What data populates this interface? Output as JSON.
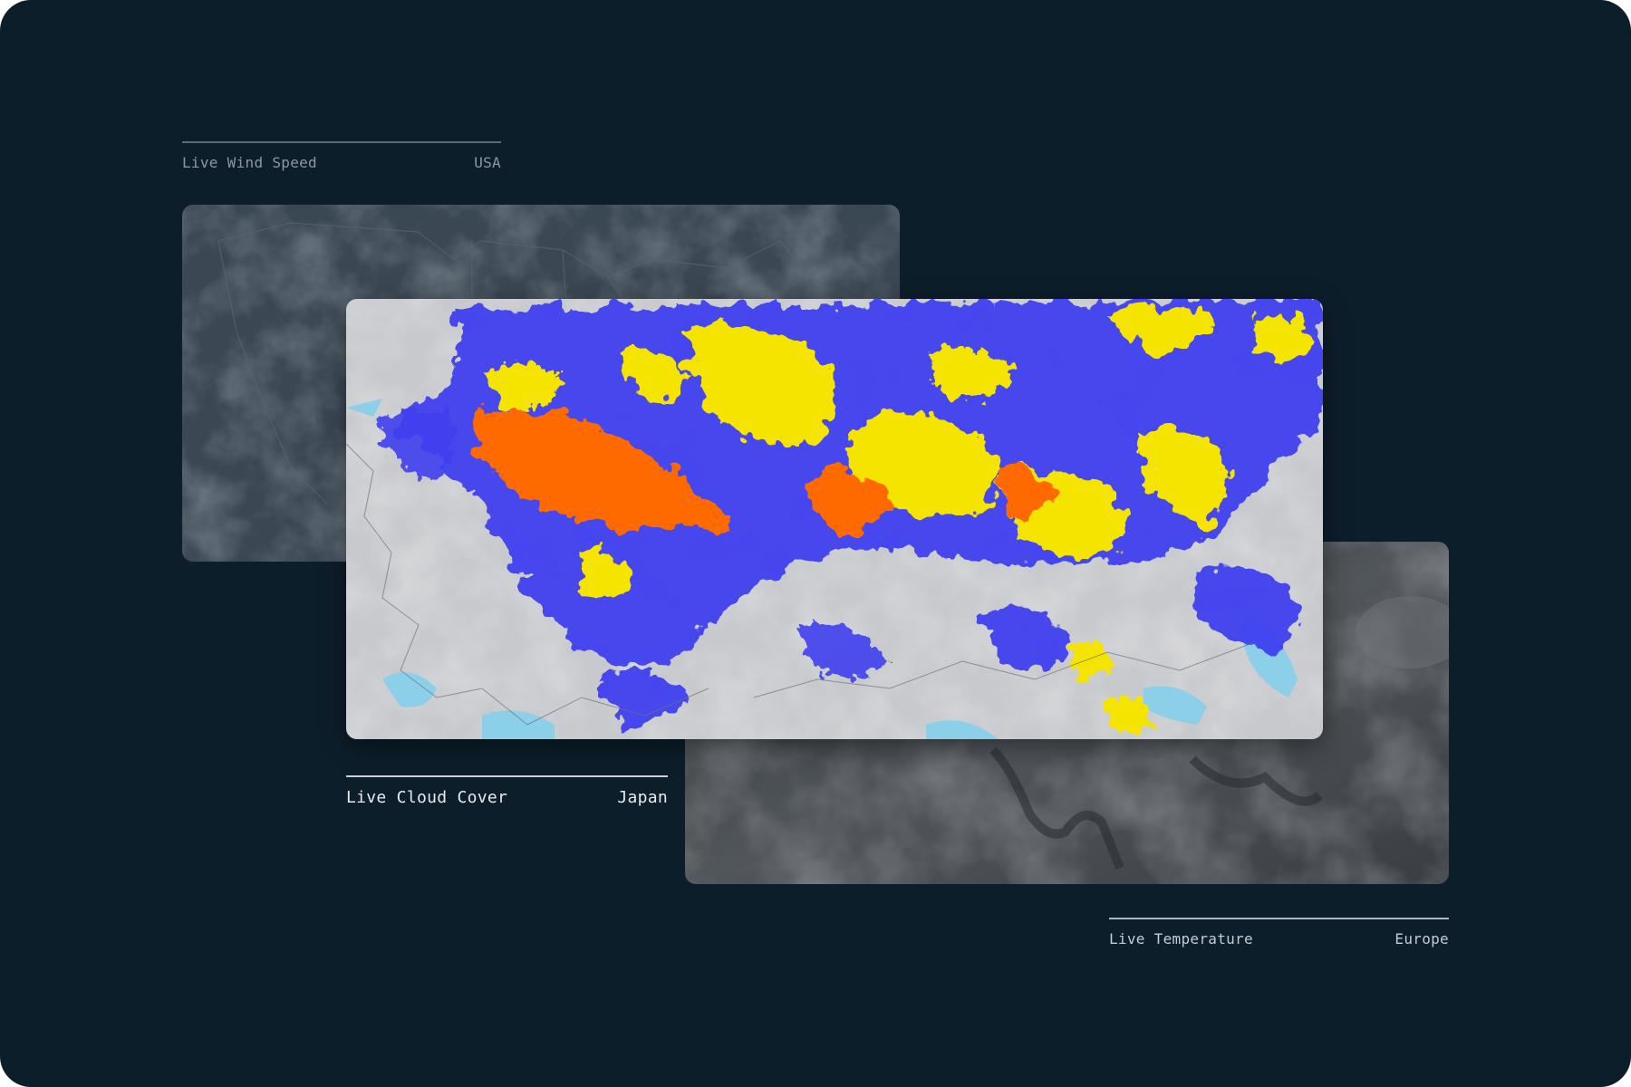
{
  "panels": {
    "wind": {
      "label": "Live Wind Speed",
      "region": "USA"
    },
    "cloud": {
      "label": "Live Cloud Cover",
      "region": "Japan"
    },
    "temperature": {
      "label": "Live Temperature",
      "region": "Europe"
    }
  },
  "colors": {
    "background": "#0d1e2b",
    "cloud_high": "#ff6a00",
    "cloud_mid": "#f5e400",
    "cloud_low": "#3f3ff0",
    "water": "#8ccfe8"
  }
}
